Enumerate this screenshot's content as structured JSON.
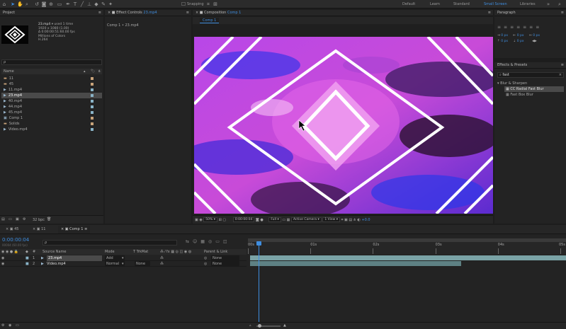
{
  "toolbar": {
    "snapping_label": "Snapping",
    "workspaces": [
      "Default",
      "Learn",
      "Standard",
      "Small Screen",
      "Libraries"
    ],
    "active_workspace_index": 3
  },
  "project_panel": {
    "title": "Project",
    "preview_name": "23.mp4",
    "preview_used": "used 1 time",
    "preview_info": [
      "1920 x 1080 (1.00)",
      "Δ 0:00:00:51:60.00 fps",
      "Millions of Colors",
      "H.264"
    ],
    "search_placeholder": "ρ",
    "column_name": "Name",
    "items": [
      {
        "name": "11",
        "type": "folder",
        "color": "#c8a37a"
      },
      {
        "name": "45",
        "type": "folder",
        "color": "#c8a37a"
      },
      {
        "name": "11.mp4",
        "type": "video",
        "color": "#8ab4c8"
      },
      {
        "name": "23.mp4",
        "type": "video",
        "color": "#8ab4c8"
      },
      {
        "name": "40.mp4",
        "type": "video",
        "color": "#8ab4c8"
      },
      {
        "name": "44.mp4",
        "type": "video",
        "color": "#8ab4c8"
      },
      {
        "name": "45.mp4",
        "type": "video",
        "color": "#8ab4c8"
      },
      {
        "name": "Comp 1",
        "type": "comp",
        "color": "#c8a37a"
      },
      {
        "name": "Solids",
        "type": "folder",
        "color": "#c8a37a"
      },
      {
        "name": "Video.mp4",
        "type": "video",
        "color": "#8ab4c8"
      }
    ],
    "selected_index": 3,
    "bpc": "32 bpc"
  },
  "effect_controls": {
    "title": "Effect Controls",
    "layer": "23.mp4",
    "subtitle": "Comp 1 • 23.mp4"
  },
  "composition": {
    "title": "Composition",
    "name": "Comp 1",
    "tab": "Comp 1",
    "zoom": "50%",
    "timecode": "0:00:00:04",
    "resolution": "Full",
    "camera": "Active Camera",
    "views": "1 View",
    "exposure": "+0.0"
  },
  "paragraph": {
    "title": "Paragraph",
    "indent_values": [
      "0 px",
      "0 px",
      "0 px",
      "0 px",
      "0 px"
    ]
  },
  "effects_presets": {
    "title": "Effects & Presets",
    "search_value": "fast",
    "category": "Blur & Sharpen",
    "items": [
      "CC Radial Fast Blur",
      "Fast Box Blur"
    ],
    "selected_index": 0
  },
  "timeline": {
    "tabs": [
      "45",
      "11",
      "Comp 1"
    ],
    "active_tab_index": 2,
    "timecode": "0:00:00:04",
    "frame_info": "00004 (60.00 fps)",
    "search_placeholder": "ρ",
    "columns": {
      "source_name": "Source Name",
      "mode": "Mode",
      "trkmat": "T TrkMat",
      "parent": "Parent & Link"
    },
    "layers": [
      {
        "num": "1",
        "name": "23.mp4",
        "mode": "Add",
        "trkmat": "",
        "parent": "None",
        "selected": true
      },
      {
        "num": "2",
        "name": "Video.mp4",
        "mode": "Normal",
        "trkmat": "None",
        "parent": "None",
        "selected": false
      }
    ],
    "ruler_labels": [
      "00s",
      "01s",
      "02s",
      "03s",
      "04s",
      "05s"
    ]
  }
}
